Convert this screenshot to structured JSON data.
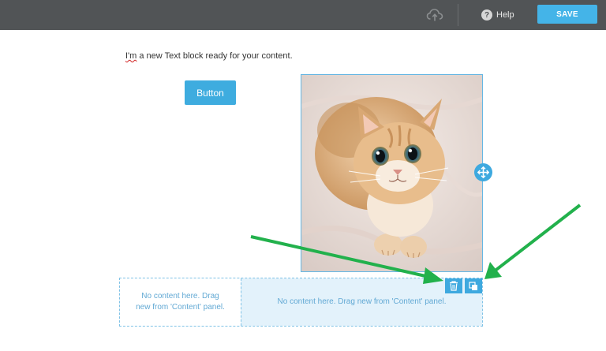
{
  "topbar": {
    "cloud_icon": "cloud-upload-icon",
    "help_icon_glyph": "?",
    "help_label": "Help",
    "save_label": "SAVE"
  },
  "canvas": {
    "text_block": {
      "first_word": "I'm",
      "rest": " a new Text block ready for your content."
    },
    "button_block": {
      "label": "Button"
    },
    "image_block": {
      "subject": "cat-photo"
    },
    "empty_row": {
      "left_placeholder": "No content here. Drag new from 'Content' panel.",
      "right_placeholder": "No content here. Drag new from 'Content' panel."
    },
    "toolbar": {
      "delete_icon": "trash-icon",
      "duplicate_icon": "duplicate-icon"
    }
  },
  "colors": {
    "topbar_bg": "#515456",
    "accent": "#44b4e8",
    "selection_border": "#65b7e4",
    "annotation_arrow": "#22b14c"
  }
}
